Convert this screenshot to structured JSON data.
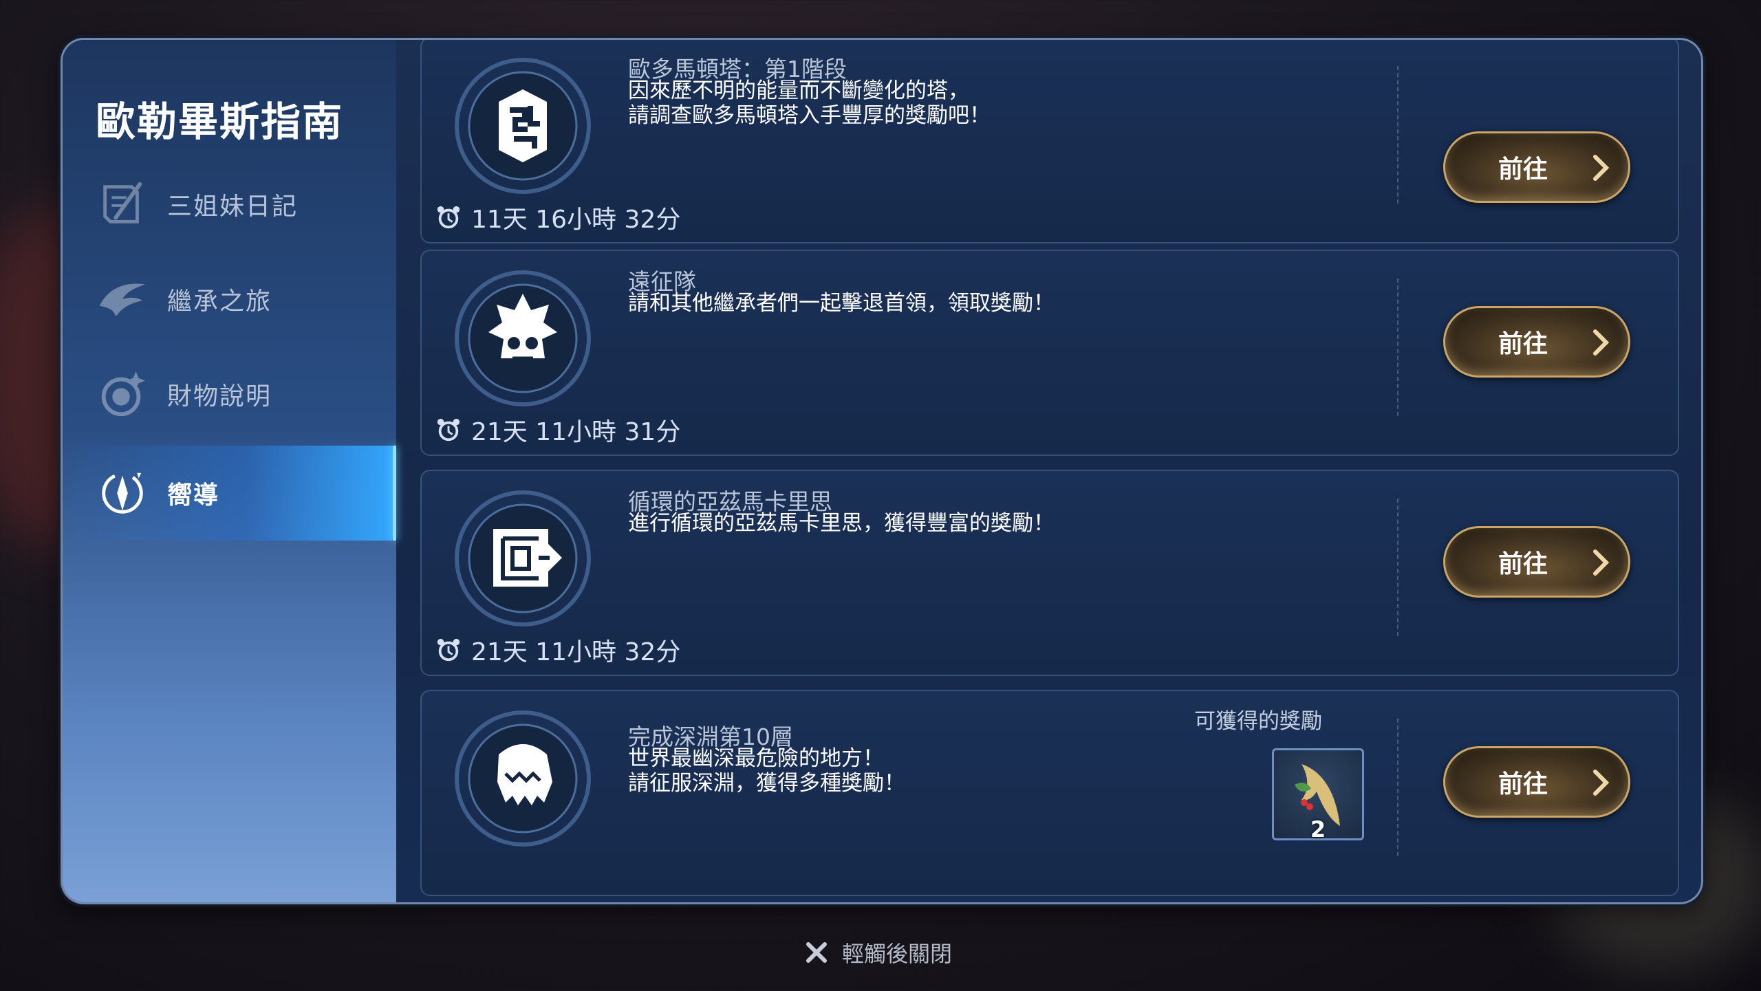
{
  "colors": {
    "accent": "#33a8ff",
    "button_gold": "#c9a567",
    "panel": "#15294a"
  },
  "sidebar": {
    "title": "歐勒畢斯指南",
    "items": [
      {
        "label": "三姐妹日記",
        "icon": "quill-scroll-icon",
        "active": false
      },
      {
        "label": "繼承之旅",
        "icon": "wing-claw-icon",
        "active": false
      },
      {
        "label": "財物說明",
        "icon": "gem-orb-icon",
        "active": false
      },
      {
        "label": "嚮導",
        "icon": "compass-icon",
        "active": true
      }
    ]
  },
  "content": {
    "cards": [
      {
        "icon": "tower-rune-icon",
        "name": "歐多馬頓塔：第1階段",
        "desc": [
          "因來歷不明的能量而不斷變化的塔，",
          "請調查歐多馬頓塔入手豐厚的獎勵吧！"
        ],
        "timer": "11天 16小時 32分",
        "button": "前往"
      },
      {
        "icon": "skull-crown-icon",
        "name": "遠征隊",
        "desc": [
          "請和其他繼承者們一起擊退首領，領取獎勵！"
        ],
        "timer": "21天 11小時 31分",
        "button": "前往"
      },
      {
        "icon": "maze-arrow-icon",
        "name": "循環的亞茲馬卡里思",
        "desc": [
          "進行循環的亞茲馬卡里思，獲得豐富的獎勵！"
        ],
        "timer": "21天 11小時 32分",
        "button": "前往"
      },
      {
        "icon": "abyss-monster-icon",
        "name": "完成深淵第10層",
        "desc": [
          "世界最幽深最危險的地方！",
          "請征服深淵，獲得多種獎勵！"
        ],
        "reward_label": "可獲得的獎勵",
        "reward_count": "2",
        "reward_icon": "ginseng-root-icon",
        "button": "前往"
      }
    ]
  },
  "footer": {
    "close_label": "輕觸後關閉"
  }
}
